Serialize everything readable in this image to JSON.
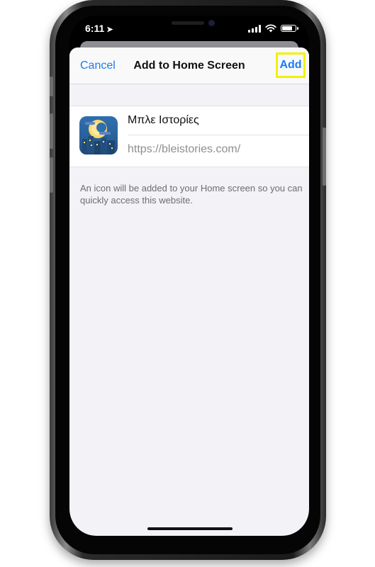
{
  "status_bar": {
    "time": "6:11",
    "location_icon": "location-arrow-icon",
    "signal_icon": "cellular-signal-icon",
    "wifi_icon": "wifi-icon",
    "battery_level": 0.8
  },
  "navbar": {
    "cancel_label": "Cancel",
    "title": "Add to Home Screen",
    "add_label": "Add"
  },
  "bookmark": {
    "icon": "bleistories-app-icon",
    "name": "Μπλε Ιστορίες",
    "url": "https://bleistories.com/"
  },
  "hint_text": "An icon will be added to your Home screen so you can quickly access this website.",
  "colors": {
    "accent": "#1a7cf5",
    "highlight_border": "#f2f200",
    "sheet_background": "#f2f2f7"
  }
}
